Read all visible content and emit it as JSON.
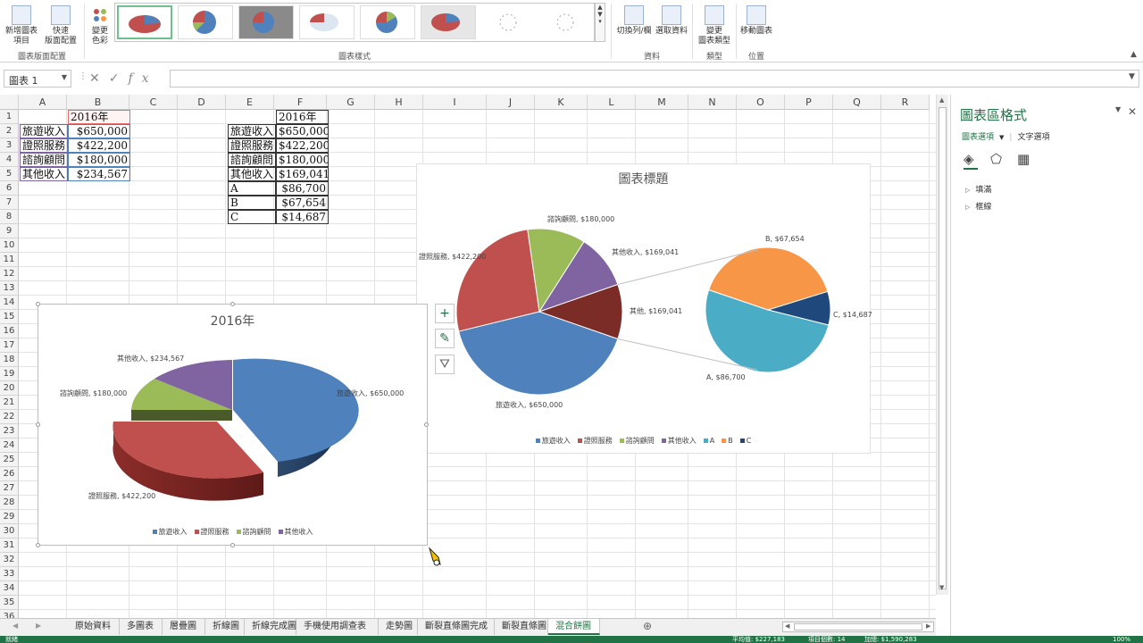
{
  "ribbon": {
    "buttons": {
      "add_element": "新增圖表\n項目",
      "quick_layout": "快速\n版面配置",
      "change_colors": "變更\n色彩",
      "switch_row_col": "切換列/欄",
      "select_data": "選取資料",
      "change_type": "變更\n圖表類型",
      "move_chart": "移動圖表"
    },
    "groups": {
      "layouts": "圖表版面配置",
      "styles": "圖表樣式",
      "data": "資料",
      "type": "類型",
      "location": "位置"
    }
  },
  "formula_bar": {
    "name_box": "圖表 1",
    "fx": "fx",
    "value": ""
  },
  "columns": [
    "A",
    "B",
    "C",
    "D",
    "E",
    "F",
    "G",
    "H",
    "I",
    "J",
    "K",
    "L",
    "M",
    "N",
    "O",
    "P",
    "Q",
    "R"
  ],
  "rows": [
    "1",
    "2",
    "3",
    "4",
    "5",
    "6",
    "7",
    "8",
    "9",
    "10",
    "11",
    "12",
    "13",
    "14",
    "15",
    "16",
    "17",
    "18",
    "19",
    "20",
    "21",
    "22",
    "23",
    "24",
    "25",
    "26",
    "27",
    "28",
    "29",
    "30",
    "31",
    "32",
    "33",
    "34",
    "35",
    "36"
  ],
  "table1": {
    "header": "2016年",
    "rows": [
      {
        "label": "旅遊收入",
        "value": "$650,000"
      },
      {
        "label": "證照服務",
        "value": "$422,200"
      },
      {
        "label": "諮詢顧問",
        "value": "$180,000"
      },
      {
        "label": "其他收入",
        "value": "$234,567"
      }
    ]
  },
  "table2": {
    "header": "2016年",
    "rows": [
      {
        "label": "旅遊收入",
        "value": "$650,000"
      },
      {
        "label": "證照服務",
        "value": "$422,200"
      },
      {
        "label": "諮詢顧問",
        "value": "$180,000"
      },
      {
        "label": "其他收入",
        "value": "$169,041"
      },
      {
        "label": "A",
        "value": "$86,700"
      },
      {
        "label": "B",
        "value": "$67,654"
      },
      {
        "label": "C",
        "value": "$14,687"
      }
    ]
  },
  "chart_data": [
    {
      "type": "pie",
      "title": "2016年",
      "categories": [
        "旅遊收入",
        "證照服務",
        "諮詢顧問",
        "其他收入"
      ],
      "values": [
        650000,
        422200,
        180000,
        234567
      ],
      "labels": [
        "旅遊收入, $650,000",
        "證照服務, $422,200",
        "諮詢顧問, $180,000",
        "其他收入, $234,567"
      ],
      "colors": [
        "#4f81bd",
        "#c0504d",
        "#9bbb59",
        "#8064a2"
      ],
      "style": "3d-exploded",
      "legend": "bottom"
    },
    {
      "type": "pie",
      "subtype": "pie-of-pie",
      "title": "圖表標題",
      "categories": [
        "旅遊收入",
        "證照服務",
        "諮詢顧問",
        "其他收入",
        "A",
        "B",
        "C"
      ],
      "values": [
        650000,
        422200,
        180000,
        169041,
        86700,
        67654,
        14687
      ],
      "other_label": "其他, $169,041",
      "labels": [
        "旅遊收入, $650,000",
        "證照服務, $422,200",
        "諮詢顧問, $180,000",
        "其他收入, $169,041",
        "A, $86,700",
        "B, $67,654",
        "C, $14,687"
      ],
      "colors": [
        "#4f81bd",
        "#c0504d",
        "#9bbb59",
        "#8064a2",
        "#4bacc6",
        "#f79646",
        "#1f497d"
      ],
      "other_color": "#7b2c26",
      "legend": "bottom"
    }
  ],
  "chart_buttons": {
    "add": "+",
    "style": "brush",
    "filter": "filter"
  },
  "pane": {
    "title": "圖表區格式",
    "tab_chart_options": "圖表選項",
    "tab_text_options": "文字選項",
    "items": [
      "填滿",
      "框線"
    ]
  },
  "sheet_tabs": [
    "原始資料",
    "多圖表",
    "層疊圖",
    "折線圖",
    "折線完成圖",
    "手機使用調查表",
    "走勢圖",
    "斷裂直條圖完成",
    "斷裂直條圖",
    "混合餅圖"
  ],
  "active_tab": "混合餅圖",
  "status": {
    "ready": "就緒",
    "average": "平均值: $227,183",
    "count": "項目個數: 14",
    "sum": "加總: $1,590,283",
    "zoom": "100%"
  }
}
